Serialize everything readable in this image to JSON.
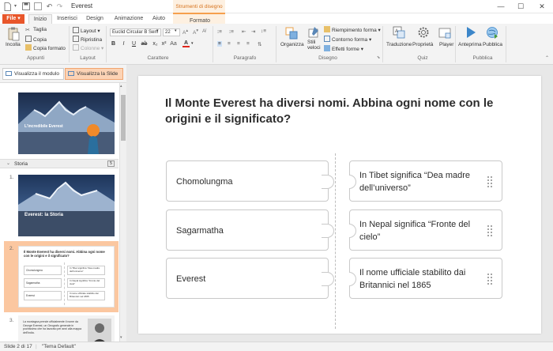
{
  "app": {
    "doc_title": "Everest",
    "file_label": "File",
    "tabs": [
      "Inizio",
      "Inserisci",
      "Design",
      "Animazione",
      "Aiuto",
      "Formato"
    ],
    "context_group": "Strumenti di disegno"
  },
  "ribbon": {
    "paste": "Incolla",
    "cut": "Taglia",
    "copy": "Copia",
    "format_painter": "Copia formato",
    "group_appunti": "Appunti",
    "layout": "Layout",
    "reset": "Ripristina",
    "columns": "Colonne",
    "group_layout": "Layout",
    "font_name": "Euclid Circular B Sem",
    "font_size": "22",
    "group_carattere": "Carattere",
    "group_paragrafo": "Paragrafo",
    "arrange": "Organizza",
    "quick_styles": "Stili veloci",
    "shape_fill": "Riempimento forma",
    "shape_outline": "Contorno forma",
    "shape_effects": "Effetti forme",
    "group_disegno": "Disegno",
    "translation": "Traduzione",
    "properties": "Proprietà",
    "player": "Player",
    "group_quiz": "Quiz",
    "preview": "Anteprima",
    "publish": "Pubblica",
    "group_pubblica": "Pubblica"
  },
  "viewbar": {
    "form_view": "Visualizza il modulo",
    "slide_view": "Visualizza la Slide"
  },
  "slides_pane": {
    "thumb1_title": "L'incredibile Everest",
    "section_name": "Storia",
    "section_count": "5",
    "thumb2_num": "1.",
    "thumb2_title": "Everest: la Storia",
    "thumb3_num": "2.",
    "thumb3_title": "Il Monte Everest ha diversi nomi. Abbina ogni nome con le origini e il significato?",
    "thumb4_num": "3.",
    "thumb4_text": "La montagna prende ufficialmente il nome da George Everest, un Geografo generale in pochissimo che ha lavorato per anni alla mappa dell'India."
  },
  "slide": {
    "question": "Il Monte Everest ha diversi nomi. Abbina ogni nome con le origini e il significato?",
    "left_items": [
      "Chomolungma",
      "Sagarmatha",
      "Everest"
    ],
    "right_items": [
      "In Tibet significa “Dea madre dell’universo”",
      "In Nepal significa “Fronte del cielo”",
      "Il nome ufficiale stabilito dai Britannici nel 1865"
    ]
  },
  "status": {
    "slide_info": "Slide 2 di 17",
    "theme": "\"Tema Default\""
  },
  "colors": {
    "accent": "#e8562a",
    "context_orange": "#f6a04d",
    "selection": "#fbc7a0"
  }
}
